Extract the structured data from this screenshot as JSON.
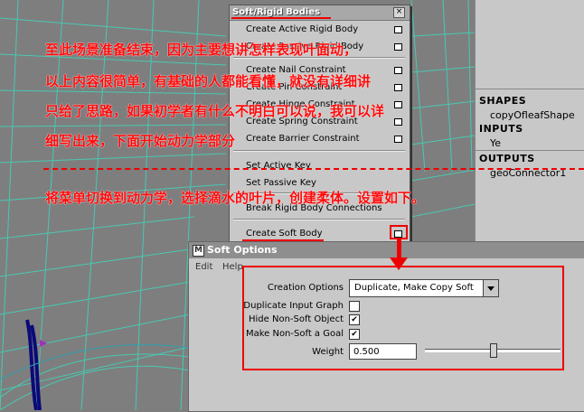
{
  "annotations": {
    "line1": "至此场景准备结束，因为主要想讲怎样表现叶面动，",
    "line2": "以上内容很简单，有基础的人都能看懂，就没有详细讲",
    "line3": "只给了思路，如果初学者有什么不明白可以说，我可以详",
    "line4": "细写出来，下面开始动力学部分",
    "line5": "将菜单切换到动力学，选择滴水的叶片，创建柔体。设置如下。"
  },
  "soft_rigid_menu": {
    "title": "Soft/Rigid Bodies",
    "close_glyph": "×",
    "items": [
      {
        "label": "Create Active Rigid Body"
      },
      {
        "label": "Create Passive Rigid Body"
      },
      {
        "label": "Create Nail Constraint"
      },
      {
        "label": "Create Pin Constraint"
      },
      {
        "label": "Create Hinge Constraint"
      },
      {
        "label": "Create Spring Constraint"
      },
      {
        "label": "Create Barrier Constraint"
      },
      {
        "label": "Set Active Key"
      },
      {
        "label": "Set Passive Key"
      },
      {
        "label": "Break Rigid Body Connections"
      },
      {
        "label": "Create Soft Body"
      }
    ]
  },
  "channel_box": {
    "shapes_header": "SHAPES",
    "shape_item": "copyOfleafShape",
    "inputs_header": "INPUTS",
    "input_item": "Ye",
    "outputs_header": "OUTPUTS",
    "output_item": "geoConnector1"
  },
  "soft_options": {
    "title": "Soft Options",
    "icon_glyph": "M",
    "menus": {
      "edit": "Edit",
      "help": "Help"
    },
    "creation_options_label": "Creation Options",
    "creation_options_value": "Duplicate, Make Copy Soft",
    "duplicate_input_graph_label": "Duplicate Input Graph",
    "duplicate_input_graph_checked": false,
    "hide_non_soft_label": "Hide Non-Soft Object",
    "hide_non_soft_checked": true,
    "make_goal_label": "Make Non-Soft a Goal",
    "make_goal_checked": true,
    "weight_label": "Weight",
    "weight_value": "0.500",
    "weight_slider_fraction": 0.5
  },
  "colors": {
    "annotation": "#ff0a0a",
    "grid": "#44c8b0",
    "curve": "#0a0a7a"
  }
}
